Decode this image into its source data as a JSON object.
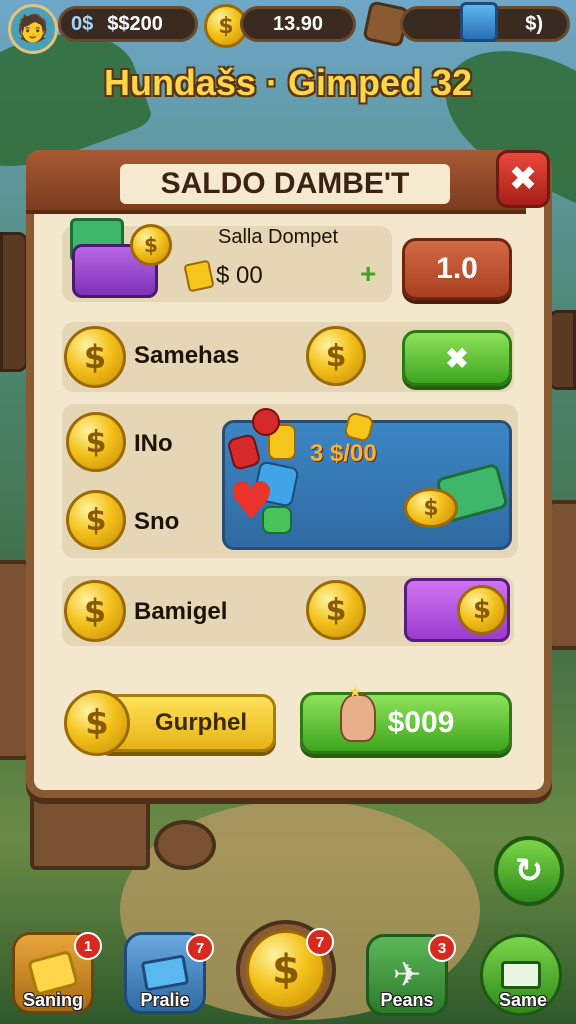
{
  "hud": {
    "stat_label": "0$",
    "cash_value": "$$200",
    "coins_value": "13.90",
    "gems_value": "$)"
  },
  "screen_title": "Hundašs · Gimped 32",
  "dialog": {
    "title": "SALDO DAMBE'T",
    "close_glyph": "✖",
    "balance": {
      "heading": "Salla Dompet",
      "amount": "$ 00",
      "plus_glyph": "+",
      "button_label": "1.0"
    },
    "rows": [
      {
        "label": "Samehas",
        "button_glyph": "✖"
      },
      {
        "label": "INo"
      },
      {
        "label": "Sno"
      },
      {
        "label": "Bamigel"
      }
    ],
    "prize_amount": "3 $/00",
    "footer": {
      "left_label": "Gurphel",
      "right_label": "$009"
    }
  },
  "fab_glyph": "↻",
  "nav": [
    {
      "label": "Saning",
      "badge": "1"
    },
    {
      "label": "Pralie",
      "badge": "7"
    },
    {
      "label": "",
      "badge": "7"
    },
    {
      "label": "Peans",
      "badge": "3"
    },
    {
      "label": "Same",
      "badge": ""
    }
  ],
  "colors": {
    "accent_green": "#3ea51f",
    "accent_red": "#a83f20",
    "gold": "#f3c21b",
    "wood": "#8a5a33"
  }
}
